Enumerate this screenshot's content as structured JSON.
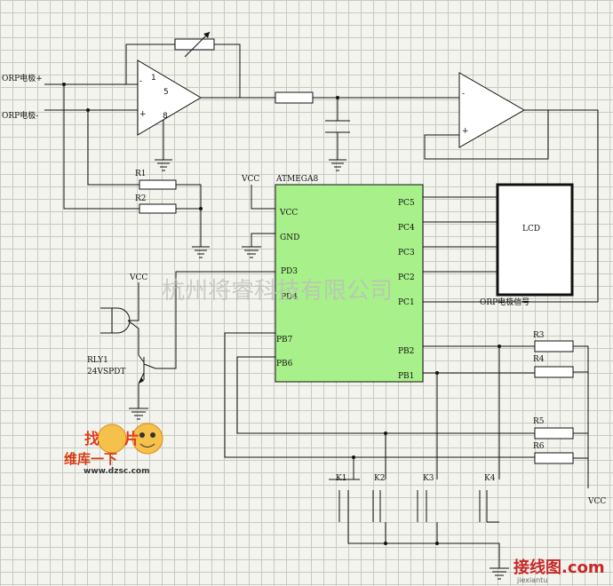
{
  "labels": {
    "orp_plus": "ORP电极+",
    "orp_minus": "ORP电极-",
    "r1": "R1",
    "r2": "R2",
    "r3": "R3",
    "r4": "R4",
    "r5": "R5",
    "r6": "R6",
    "vcc": "VCC",
    "mcu": "ATMEGA8",
    "gnd_pin": "GND",
    "lcd": "LCD",
    "orp_signal": "ORP电极信号",
    "relay": "RLY1",
    "relay_type": "24VSPDT",
    "k1": "K1",
    "k2": "K2",
    "k3": "K3",
    "k4": "K4",
    "opamp_pin_1": "1",
    "opamp_pin_5": "5",
    "opamp_pin_8": "8",
    "minus": "-",
    "plus": "+"
  },
  "mcu_pins": {
    "vcc": "VCC",
    "gnd": "GND",
    "pd3": "PD3",
    "pd4": "PD4",
    "pb7": "PB7",
    "pb6": "PB6",
    "pc5": "PC5",
    "pc4": "PC4",
    "pc3": "PC3",
    "pc2": "PC2",
    "pc1": "PC1",
    "pb2": "PB2",
    "pb1": "PB1"
  },
  "watermark": "杭州将睿科技有限公司",
  "logo": {
    "top": "找",
    "top_right": "片",
    "middle": "维库一下",
    "url": "www.dzsc.com"
  },
  "corner_logo": {
    "brand": "接线图",
    "suffix": ".com",
    "sub": "jiexiantu"
  },
  "colors": {
    "mcu_fill": "#a8f08a",
    "grid": "#c9c9c2",
    "background": "#f4f4ef"
  }
}
